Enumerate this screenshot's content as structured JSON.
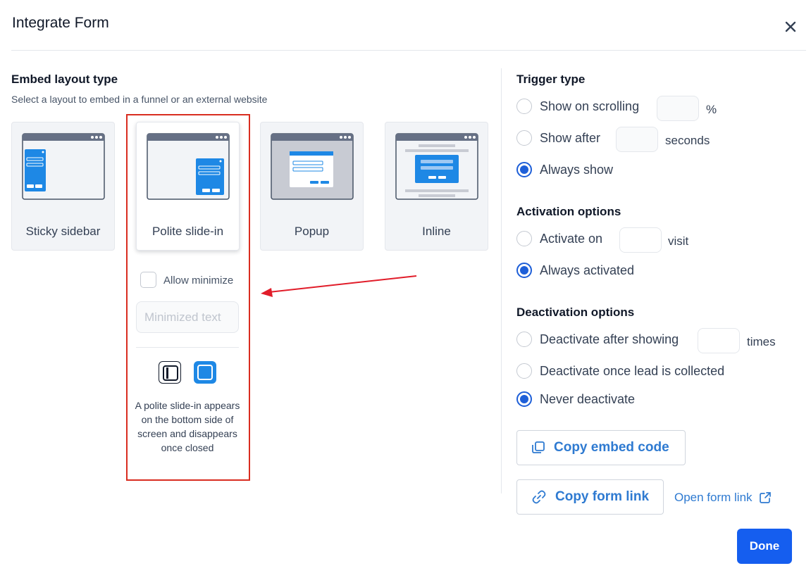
{
  "modal": {
    "title": "Integrate Form",
    "done_label": "Done"
  },
  "embed": {
    "title": "Embed layout type",
    "subtitle": "Select a layout to embed in a funnel or an external website",
    "layouts": [
      {
        "label": "Sticky sidebar",
        "selected": false
      },
      {
        "label": "Polite slide-in",
        "selected": true
      },
      {
        "label": "Popup",
        "selected": false
      },
      {
        "label": "Inline",
        "selected": false
      }
    ],
    "allow_minimize_label": "Allow minimize",
    "allow_minimize_checked": false,
    "minimized_placeholder": "Minimized text",
    "description": "A polite slide-in appears on the bottom side of screen and disappears once closed"
  },
  "trigger": {
    "title": "Trigger type",
    "options": [
      {
        "label": "Show on scrolling",
        "unit": "%",
        "checked": false
      },
      {
        "label": "Show after",
        "unit": "seconds",
        "checked": false
      },
      {
        "label": "Always show",
        "checked": true
      }
    ]
  },
  "activation": {
    "title": "Activation options",
    "options": [
      {
        "label": "Activate on",
        "unit": "visit",
        "checked": false
      },
      {
        "label": "Always activated",
        "checked": true
      }
    ]
  },
  "deactivation": {
    "title": "Deactivation options",
    "options": [
      {
        "label": "Deactivate after showing",
        "unit": "times",
        "checked": false
      },
      {
        "label": "Deactivate once lead is collected",
        "checked": false
      },
      {
        "label": "Never deactivate",
        "checked": true
      }
    ]
  },
  "actions": {
    "copy_embed_label": "Copy embed code",
    "copy_link_label": "Copy form link",
    "open_link_label": "Open form link"
  },
  "colors": {
    "accent": "#155eef",
    "link": "#2e7ad1",
    "radio": "#1e5fd8",
    "highlight": "#d92d20",
    "preview_blue": "#1e88e5"
  }
}
